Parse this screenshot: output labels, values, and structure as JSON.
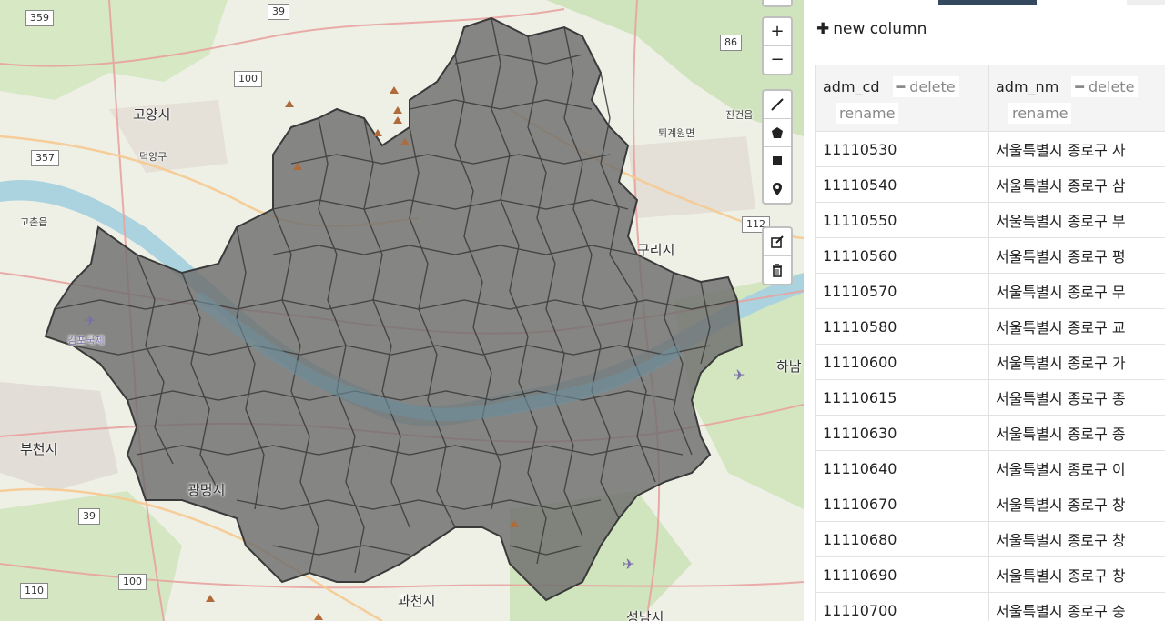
{
  "map": {
    "place_labels": [
      {
        "text": "고양시"
      },
      {
        "text": "덕양구"
      },
      {
        "text": "구리시"
      },
      {
        "text": "부천시"
      },
      {
        "text": "광명시"
      },
      {
        "text": "과천시"
      },
      {
        "text": "성남시"
      },
      {
        "text": "하남"
      },
      {
        "text": "고촌읍"
      },
      {
        "text": "진건읍"
      },
      {
        "text": "퇴계원면"
      },
      {
        "text": "김포국제"
      }
    ],
    "road_shields": [
      "359",
      "39",
      "100",
      "86",
      "357",
      "112",
      "39",
      "100",
      "110"
    ],
    "colors": {
      "district_fill": "#6e6e6e",
      "district_stroke": "#3a3a3a",
      "river": "#aad3df",
      "land": "#eef0e6"
    }
  },
  "controls": {
    "zoom_in": "+",
    "zoom_out": "−",
    "draw_tools": [
      "polyline-icon",
      "polygon-icon",
      "rectangle-icon",
      "marker-icon"
    ],
    "edit_tools": [
      "edit-icon",
      "trash-icon"
    ]
  },
  "panel": {
    "new_column_label": "new column",
    "columns": [
      {
        "name": "adm_cd",
        "delete": "delete",
        "rename": "rename"
      },
      {
        "name": "adm_nm",
        "delete": "delete",
        "rename": "rename"
      }
    ],
    "rows": [
      {
        "adm_cd": "11110530",
        "adm_nm": "서울특별시 종로구 사"
      },
      {
        "adm_cd": "11110540",
        "adm_nm": "서울특별시 종로구 삼"
      },
      {
        "adm_cd": "11110550",
        "adm_nm": "서울특별시 종로구 부"
      },
      {
        "adm_cd": "11110560",
        "adm_nm": "서울특별시 종로구 평"
      },
      {
        "adm_cd": "11110570",
        "adm_nm": "서울특별시 종로구 무"
      },
      {
        "adm_cd": "11110580",
        "adm_nm": "서울특별시 종로구 교"
      },
      {
        "adm_cd": "11110600",
        "adm_nm": "서울특별시 종로구 가"
      },
      {
        "adm_cd": "11110615",
        "adm_nm": "서울특별시 종로구 종"
      },
      {
        "adm_cd": "11110630",
        "adm_nm": "서울특별시 종로구 종"
      },
      {
        "adm_cd": "11110640",
        "adm_nm": "서울특별시 종로구 이"
      },
      {
        "adm_cd": "11110670",
        "adm_nm": "서울특별시 종로구 창"
      },
      {
        "adm_cd": "11110680",
        "adm_nm": "서울특별시 종로구 창"
      },
      {
        "adm_cd": "11110690",
        "adm_nm": "서울특별시 종로구 창"
      },
      {
        "adm_cd": "11110700",
        "adm_nm": "서울특별시 종로구 숭"
      }
    ]
  }
}
